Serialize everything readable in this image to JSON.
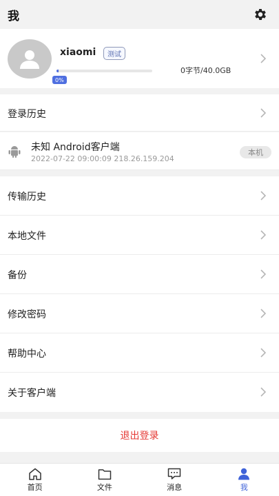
{
  "header": {
    "title": "我",
    "settings_icon": "gear-icon"
  },
  "profile": {
    "username": "xiaomi",
    "tag": "测试",
    "storage_percent_label": "0%",
    "storage_fill": 0.02,
    "storage_text": "0字节/40.0GB",
    "avatar_icon": "user-avatar-icon"
  },
  "login_history": {
    "label": "登录历史"
  },
  "device": {
    "name": "未知 Android客户端",
    "meta": "2022-07-22 09:00:09 218.26.159.204",
    "badge": "本机",
    "icon": "android-icon"
  },
  "menu": {
    "transfer_history": "传输历史",
    "local_files": "本地文件",
    "backup": "备份",
    "change_password": "修改密码",
    "help_center": "帮助中心",
    "about": "关于客户端"
  },
  "logout": {
    "label": "退出登录"
  },
  "tabs": [
    {
      "label": "首页",
      "icon": "home-icon"
    },
    {
      "label": "文件",
      "icon": "folder-icon"
    },
    {
      "label": "消息",
      "icon": "message-icon"
    },
    {
      "label": "我",
      "icon": "person-icon"
    }
  ],
  "colors": {
    "accent": "#4f6fe0",
    "logout": "#e53935",
    "active_tab": "#3f63d9"
  }
}
